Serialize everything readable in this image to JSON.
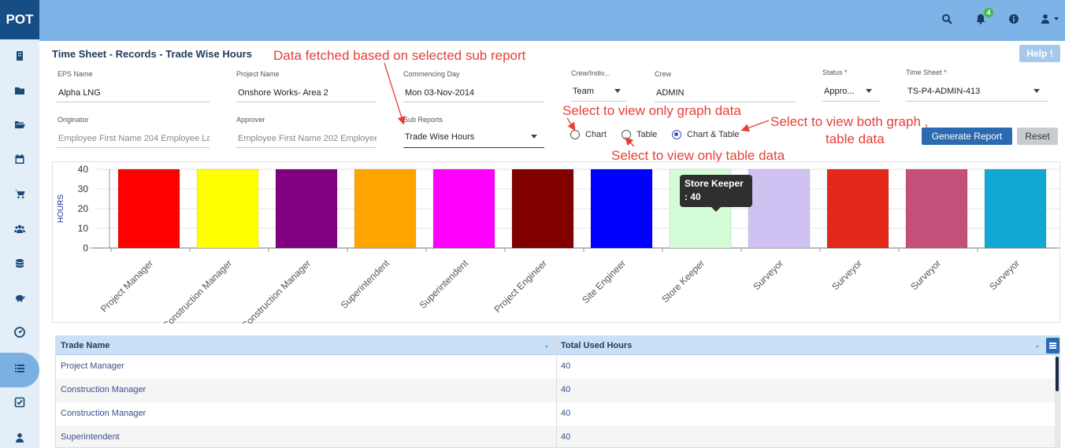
{
  "app": {
    "logo": "POT"
  },
  "sidebar": {
    "items": [
      {
        "icon": "building-icon"
      },
      {
        "icon": "folder-icon"
      },
      {
        "icon": "folder-open-icon"
      },
      {
        "icon": "calendar-icon"
      },
      {
        "icon": "cart-icon"
      },
      {
        "icon": "users-icon"
      },
      {
        "icon": "database-icon"
      },
      {
        "icon": "piggy-bank-icon"
      },
      {
        "icon": "dashboard-icon"
      },
      {
        "icon": "list-icon",
        "active": true
      },
      {
        "icon": "checklist-icon"
      },
      {
        "icon": "user-icon"
      }
    ]
  },
  "topbar": {
    "notification_count": "4"
  },
  "page": {
    "title": "Time Sheet - Records - Trade Wise Hours",
    "help_label": "Help !"
  },
  "form": {
    "eps_name": {
      "label": "EPS Name",
      "value": "Alpha LNG"
    },
    "project_name": {
      "label": "Project Name",
      "value": "Onshore  Works- Area 2"
    },
    "commencing_day": {
      "label": "Commencing Day",
      "value": "Mon 03-Nov-2014"
    },
    "crew_indiv": {
      "label": "Crew/Indiv...",
      "value": "Team"
    },
    "crew": {
      "label": "Crew",
      "value": "ADMIN"
    },
    "status": {
      "label": "Status *",
      "value": "Appro..."
    },
    "time_sheet": {
      "label": "Time Sheet *",
      "value": "TS-P4-ADMIN-413"
    },
    "originator": {
      "label": "Originator",
      "value": "Employee First Name 204 Employee La"
    },
    "approver": {
      "label": "Approver",
      "value": "Employee First Name 202 Employee"
    },
    "sub_reports": {
      "label": "Sub Reports",
      "value": "Trade Wise Hours"
    },
    "view_options": [
      {
        "label": "Chart",
        "checked": false
      },
      {
        "label": "Table",
        "checked": false
      },
      {
        "label": "Chart & Table",
        "checked": true
      }
    ],
    "generate_label": "Generate Report",
    "reset_label": "Reset"
  },
  "annotations": {
    "sub_report": "Data fetched based on selected sub report",
    "graph_only": "Select to view only graph data",
    "table_only": "Select to view only table data",
    "both_line1": "Select to view both graph ,",
    "both_line2": "table data"
  },
  "chart_data": {
    "type": "bar",
    "ylabel": "HOURS",
    "ylim": [
      0,
      40
    ],
    "yticks": [
      "0",
      "10",
      "20",
      "30",
      "40"
    ],
    "categories": [
      "Project Manager",
      "Construction Manager",
      "Construction Manager",
      "Superintendent",
      "Superintendent",
      "Project Engineer",
      "Site Engineer",
      "Store Keeper",
      "Surveyor",
      "Surveyor",
      "Surveyor",
      "Surveyor"
    ],
    "values": [
      40,
      40,
      40,
      40,
      40,
      40,
      40,
      40,
      40,
      40,
      40,
      40
    ],
    "colors": [
      "#ff0000",
      "#ffff00",
      "#800080",
      "#ffa500",
      "#ff00ff",
      "#800000",
      "#0000ff",
      "#d4fcd7",
      "#cfc2f2",
      "#e3281c",
      "#c44f7b",
      "#11a9d3"
    ],
    "grid": true,
    "tooltip": {
      "title": "Store Keeper",
      "value": ": 40"
    }
  },
  "table": {
    "columns": [
      "Trade Name",
      "Total Used Hours"
    ],
    "rows": [
      [
        "Project Manager",
        "40"
      ],
      [
        "Construction Manager",
        "40"
      ],
      [
        "Construction Manager",
        "40"
      ],
      [
        "Superintendent",
        "40"
      ]
    ]
  }
}
